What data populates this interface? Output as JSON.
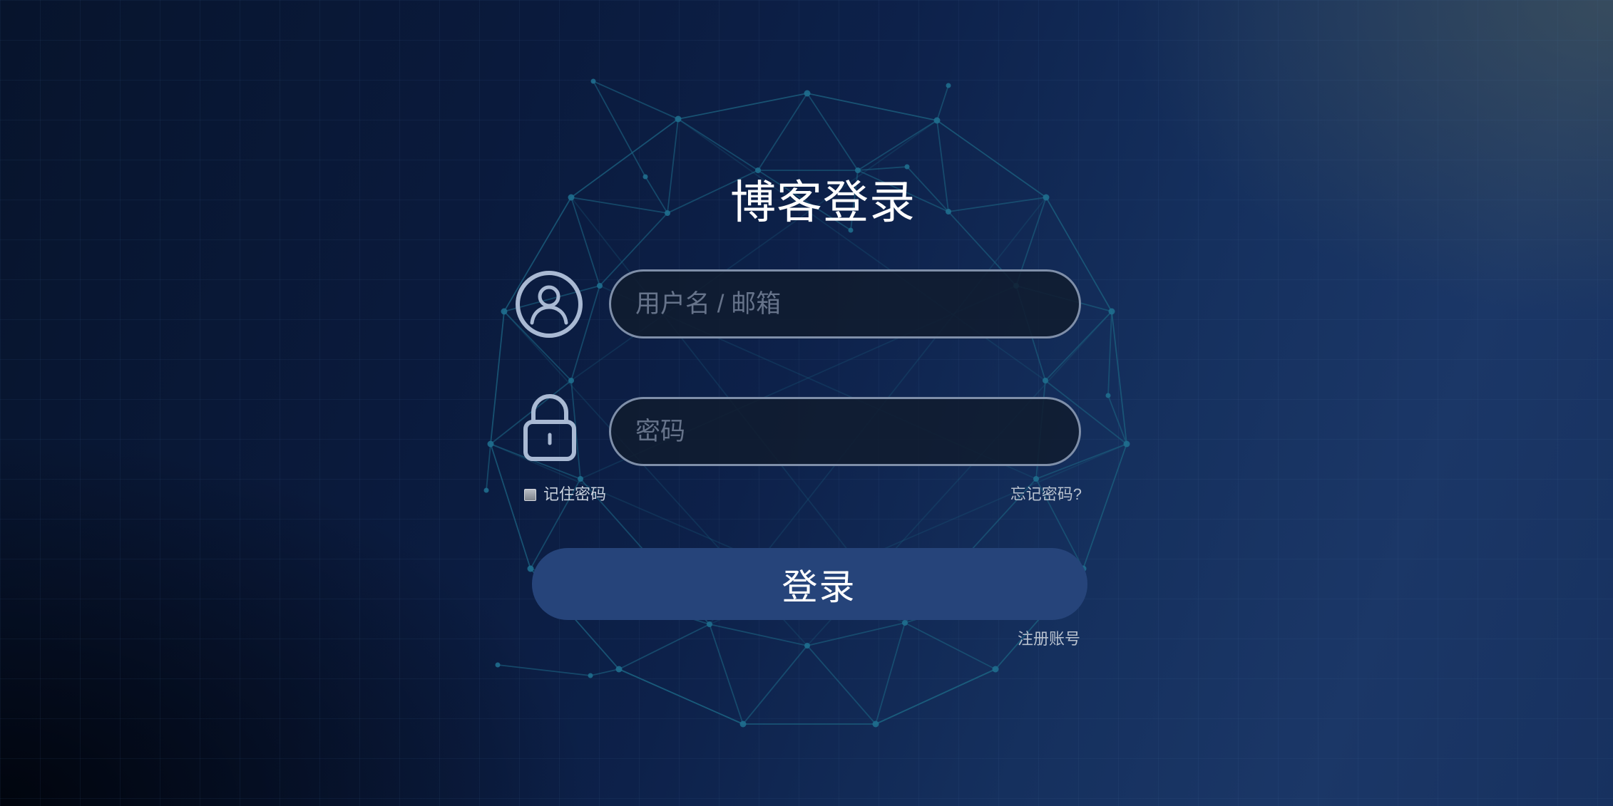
{
  "page": {
    "title": "博客登录"
  },
  "form": {
    "username": {
      "placeholder": "用户名 / 邮箱"
    },
    "password": {
      "placeholder": "密码"
    },
    "remember": {
      "label": "记住密码",
      "checked": false
    },
    "forgot_label": "忘记密码?",
    "submit_label": "登录",
    "register_label": "注册账号"
  },
  "icons": {
    "username": "user-circle-icon",
    "password": "lock-icon"
  },
  "colors": {
    "button_bg": "#26447a",
    "input_border": "#7f8fa9",
    "icon_stroke": "#a9b9d3",
    "network_line": "#1b5f7e"
  }
}
